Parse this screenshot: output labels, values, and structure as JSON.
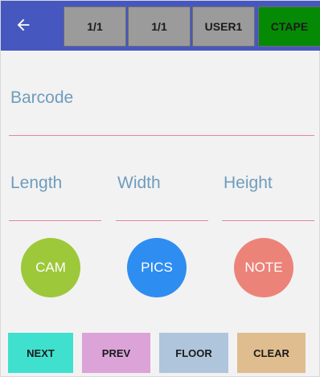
{
  "colors": {
    "topbar": "#4658bf",
    "header_button": "#9b9b9b",
    "ctape_button": "#058a05",
    "field_label": "#6e9cbd",
    "field_underline": "#e2889d",
    "cam": "#9dc83a",
    "pics": "#2e8df0",
    "note": "#ec8379",
    "next": "#40e0cf",
    "prev": "#dba3d8",
    "floor": "#aec5db",
    "clear": "#dfbd8f"
  },
  "header": {
    "back_icon": "arrow-left-icon",
    "buttons": [
      "1/1",
      "1/1",
      "USER1",
      "CTAPE"
    ]
  },
  "form": {
    "barcode": {
      "label": "Barcode",
      "value": ""
    },
    "length": {
      "label": "Length",
      "value": ""
    },
    "width": {
      "label": "Width",
      "value": ""
    },
    "height": {
      "label": "Height",
      "value": ""
    }
  },
  "actions": {
    "cam": "CAM",
    "pics": "PICS",
    "note": "NOTE"
  },
  "footer": {
    "next": "NEXT",
    "prev": "PREV",
    "floor": "FLOOR",
    "clear": "CLEAR"
  }
}
